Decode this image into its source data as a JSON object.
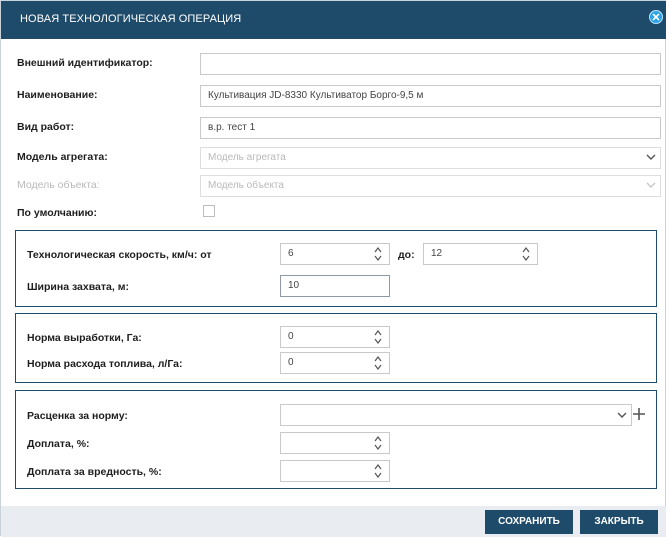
{
  "dialog": {
    "title": "НОВАЯ ТЕХНОЛОГИЧЕСКАЯ ОПЕРАЦИЯ"
  },
  "fields": {
    "external_id": {
      "label": "Внешний идентификатор:",
      "value": ""
    },
    "name": {
      "label": "Наименование:",
      "value": "Культивация JD-8330 Культиватор Борго-9,5 м"
    },
    "work_type": {
      "label": "Вид работ:",
      "value": "в.р. тест 1"
    },
    "aggregate_model": {
      "label": "Модель агрегата:",
      "placeholder": "Модель агрегата"
    },
    "object_model": {
      "label": "Модель объекта:",
      "placeholder": "Модель объекта"
    },
    "default": {
      "label": "По умолчанию:",
      "checked": false
    }
  },
  "speed_group": {
    "speed_label": "Технологическая скорость, км/ч: от",
    "speed_from": "6",
    "to_label": "до:",
    "speed_to": "12",
    "width_label": "Ширина захвата, м:",
    "width_value": "10"
  },
  "rate_group": {
    "output_label": "Норма выработки, Га:",
    "output_value": "0",
    "fuel_label": "Норма расхода топлива, л/Га:",
    "fuel_value": "0"
  },
  "pay_group": {
    "price_label": "Расценка за норму:",
    "price_value": "",
    "bonus_label": "Доплата, %:",
    "bonus_value": "",
    "hazard_label": "Доплата за вредность, %:",
    "hazard_value": ""
  },
  "buttons": {
    "save": "СОХРАНИТЬ",
    "close": "ЗАКРЫТЬ"
  },
  "icons": {
    "close": "close-icon",
    "dropdown": "chevron-down-icon",
    "spinner": "spinner-arrows-icon",
    "add": "plus-icon"
  },
  "colors": {
    "header": "#1f4b6b",
    "close_icon": "#2aa3e8",
    "footer": "#e9edf1"
  }
}
